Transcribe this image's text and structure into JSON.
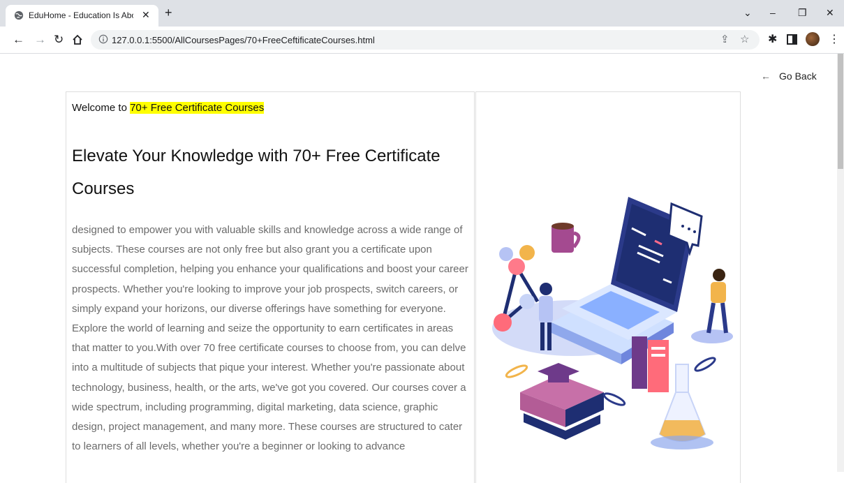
{
  "browser": {
    "tab_title": "EduHome - Education Is About ...",
    "url": "127.0.0.1:5500/AllCoursesPages/70+FreeCeftificateCourses.html"
  },
  "page": {
    "go_back": "Go Back",
    "welcome_prefix": "Welcome to ",
    "welcome_highlight": "70+ Free Certificate Courses",
    "heading": "Elevate Your Knowledge with 70+ Free Certificate Courses",
    "body": "designed to empower you with valuable skills and knowledge across a wide range of subjects. These courses are not only free but also grant you a certificate upon successful completion, helping you enhance your qualifications and boost your career prospects. Whether you're looking to improve your job prospects, switch careers, or simply expand your horizons, our diverse offerings have something for everyone. Explore the world of learning and seize the opportunity to earn certificates in areas that matter to you.With over 70 free certificate courses to choose from, you can delve into a multitude of subjects that pique your interest. Whether you're passionate about technology, business, health, or the arts, we've got you covered. Our courses cover a wide spectrum, including programming, digital marketing, data science, graphic design, project management, and many more. These courses are structured to cater to learners of all levels, whether you're a beginner or looking to advance"
  },
  "colors": {
    "highlight": "#ffff00",
    "body_text": "#6b6b6b"
  }
}
